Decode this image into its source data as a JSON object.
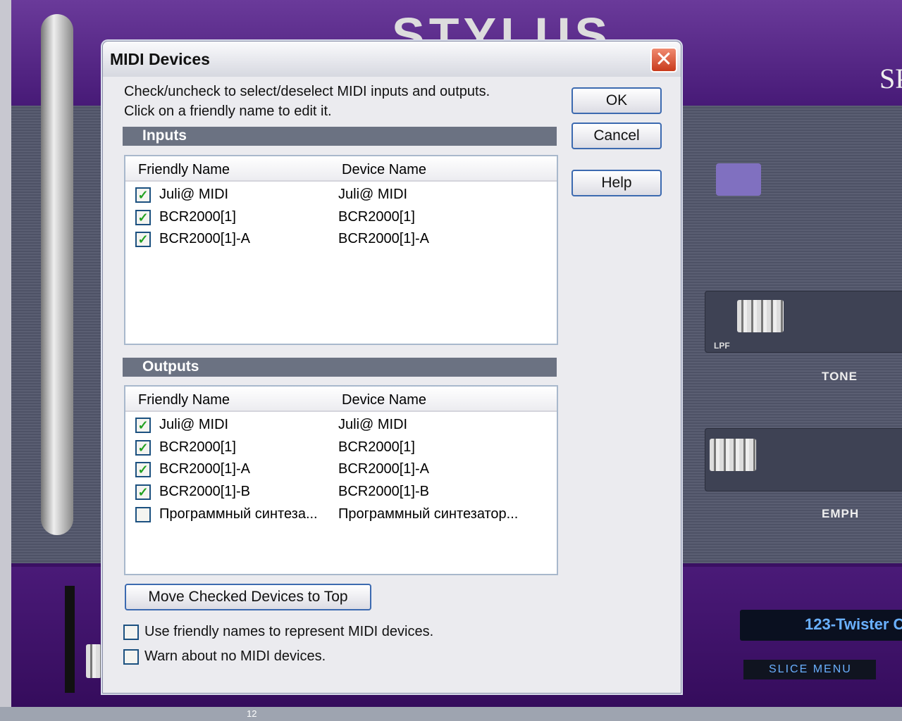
{
  "background_app": {
    "logo_text": "STYLUS",
    "brand_text": "SPE",
    "slider1_label": "TONE",
    "slider1_sub": "LPF",
    "slider2_label": "EMPH",
    "display_text": "123-Twister C",
    "slice_menu": "SLICE MENU",
    "taskbar_num": "12"
  },
  "dialog": {
    "title": "MIDI Devices",
    "instructions": [
      "Check/uncheck to select/deselect MIDI inputs and outputs.",
      "Click on a friendly name to edit it."
    ],
    "buttons": {
      "ok": "OK",
      "cancel": "Cancel",
      "help": "Help",
      "move": "Move Checked Devices to Top"
    },
    "inputs": {
      "label": "Inputs",
      "columns": [
        "Friendly Name",
        "Device Name"
      ],
      "rows": [
        {
          "checked": true,
          "friendly": "Juli@ MIDI",
          "device": "Juli@ MIDI"
        },
        {
          "checked": true,
          "friendly": "BCR2000[1]",
          "device": "BCR2000[1]"
        },
        {
          "checked": true,
          "friendly": "BCR2000[1]-A",
          "device": "BCR2000[1]-A"
        }
      ]
    },
    "outputs": {
      "label": "Outputs",
      "columns": [
        "Friendly Name",
        "Device Name"
      ],
      "rows": [
        {
          "checked": true,
          "friendly": "Juli@ MIDI",
          "device": "Juli@ MIDI"
        },
        {
          "checked": true,
          "friendly": "BCR2000[1]",
          "device": "BCR2000[1]"
        },
        {
          "checked": true,
          "friendly": "BCR2000[1]-A",
          "device": "BCR2000[1]-A"
        },
        {
          "checked": true,
          "friendly": "BCR2000[1]-B",
          "device": "BCR2000[1]-B"
        },
        {
          "checked": false,
          "friendly": "Программный синтеза...",
          "device": "Программный синтезатор..."
        }
      ]
    },
    "options": [
      {
        "checked": false,
        "label": "Use friendly names to represent MIDI devices."
      },
      {
        "checked": false,
        "label": "Warn about no MIDI devices."
      }
    ]
  }
}
